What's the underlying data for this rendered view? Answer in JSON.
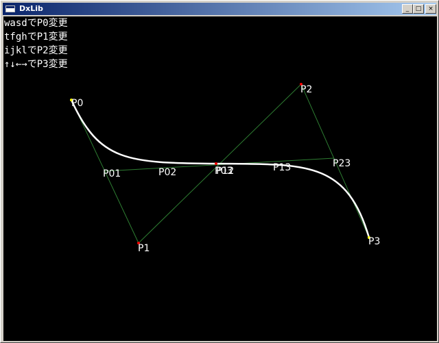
{
  "window": {
    "title": "DxLib",
    "buttons": {
      "minimize": "_",
      "maximize": "□",
      "close": "×"
    }
  },
  "help_lines": [
    "wasdでP0変更",
    "tfghでP1変更",
    "ijklでP2変更",
    "↑↓←→でP3変更"
  ],
  "points": {
    "P0": "P0",
    "P1": "P1",
    "P2": "P2",
    "P3": "P3",
    "P01": "P01",
    "P02": "P02",
    "P03": "P03",
    "P12": "P12",
    "P13": "P13",
    "P23": "P23"
  },
  "colors": {
    "background": "#000000",
    "curve": "#ffffff",
    "control_line": "#2e7d32",
    "anchor_point": "#ffff00",
    "control_point": "#ff0000"
  }
}
